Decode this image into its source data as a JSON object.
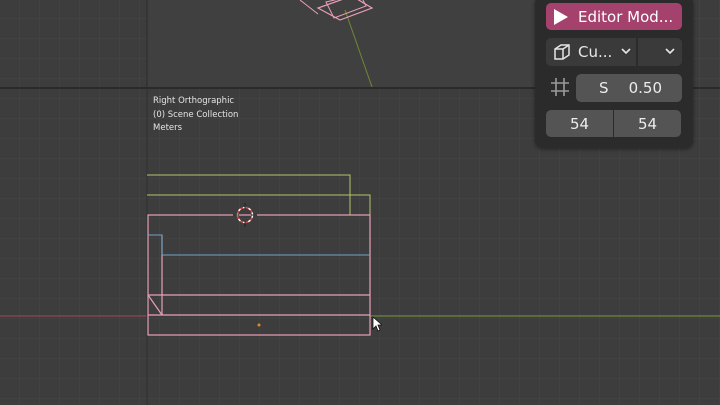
{
  "viewport": {
    "view_name": "Right Orthographic",
    "collection": "(0) Scene Collection",
    "units": "Meters"
  },
  "panel": {
    "editor_mode_label": "Editor Mod...",
    "object_select_label": "Cu...",
    "snap_label": "S",
    "snap_value": "0.50",
    "field_a": "54",
    "field_b": "54"
  },
  "icons": {
    "play": "play-icon",
    "cube": "cube-icon",
    "chevron": "chevron-down-icon",
    "grid": "grid-snap-icon",
    "cursor": "mouse-pointer-icon",
    "origin": "3d-cursor-icon"
  },
  "colors": {
    "background": "#3d3d3d",
    "grid_line": "#4a4a4a",
    "axis_red": "#8c4a55",
    "axis_green": "#6a8a3a",
    "wire_selected": "#e8a0b8",
    "wire_other": "#b9c46a",
    "accent": "#a5416d"
  }
}
